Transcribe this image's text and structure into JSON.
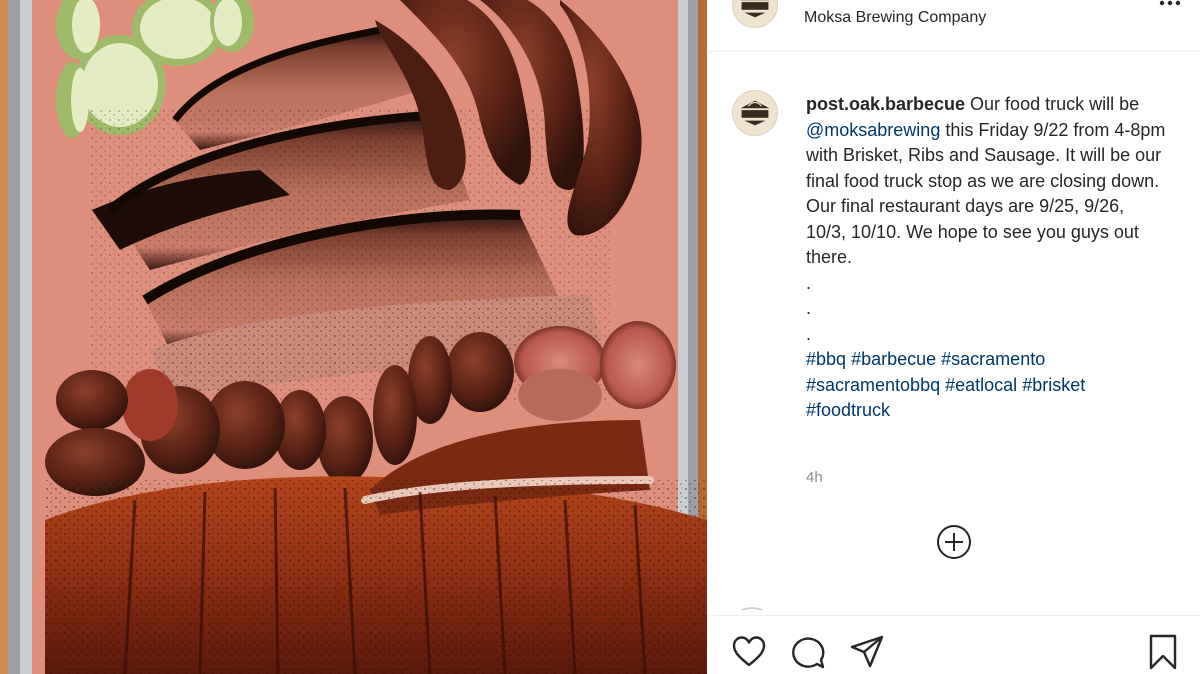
{
  "post": {
    "location": "Moksa Brewing Company",
    "caption": {
      "username": "post.oak.barbecue",
      "text_1": " Our food truck will be ",
      "mention": "@moksabrewing",
      "text_2": " this Friday 9/22 from 4-8pm with Brisket, Ribs and Sausage. It will be our final food truck stop as we are closing down. Our final restaurant days are 9/25, 9/26, 10/3, 10/10. We hope to see you guys out there.",
      "dots": [
        ".",
        ".",
        "."
      ],
      "hashtags": [
        "#bbq",
        "#barbecue",
        "#sacramento",
        "#sacramentobbq",
        "#eatlocal",
        "#brisket",
        "#foodtruck"
      ]
    },
    "timestamp": "4h"
  },
  "icons": {
    "more": "more-horizontal-icon",
    "load_more": "plus-circle-icon",
    "like": "heart-icon",
    "comment": "comment-bubble-icon",
    "share": "paper-plane-icon",
    "save": "bookmark-icon"
  },
  "colors": {
    "link": "#00376b",
    "text": "#262626",
    "muted": "#8e8e8e",
    "divider": "#efefef"
  }
}
